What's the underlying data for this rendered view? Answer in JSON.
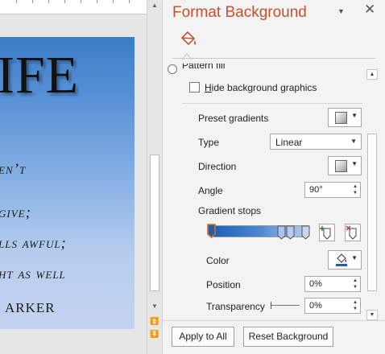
{
  "slide": {
    "title_fragment": "IFE",
    "lines": [
      "en’t",
      "give;",
      "lls awful;",
      "ht as well"
    ],
    "signature": "arker"
  },
  "pane": {
    "title": "Format Background",
    "menu_icon": "triangle-down",
    "close_icon": "close-x",
    "tab_icon": "fill-bucket-icon",
    "pattern_fill_label": "Pattern fill",
    "hide_bg_graphics_label": "Hide background graphics",
    "hide_bg_graphics_checked": false,
    "preset_gradients_label": "Preset gradients",
    "type_label": "Type",
    "type_value": "Linear",
    "direction_label": "Direction",
    "angle_label": "Angle",
    "angle_value": "90°",
    "gradient_stops_label": "Gradient stops",
    "gradient_stops_positions": [
      0,
      75,
      85,
      100
    ],
    "selected_stop": 0,
    "color_label": "Color",
    "color_swatch": "#1f5fa8",
    "position_label": "Position",
    "position_value": "0%",
    "transparency_label": "Transparency",
    "transparency_value": "0%",
    "apply_all_label": "Apply to All",
    "reset_label": "Reset Background"
  },
  "colors": {
    "title": "#c8502d",
    "gradient_start": "#1c5fb6",
    "gradient_end": "#b7cdee",
    "accent_selected": "#d26a2e"
  }
}
